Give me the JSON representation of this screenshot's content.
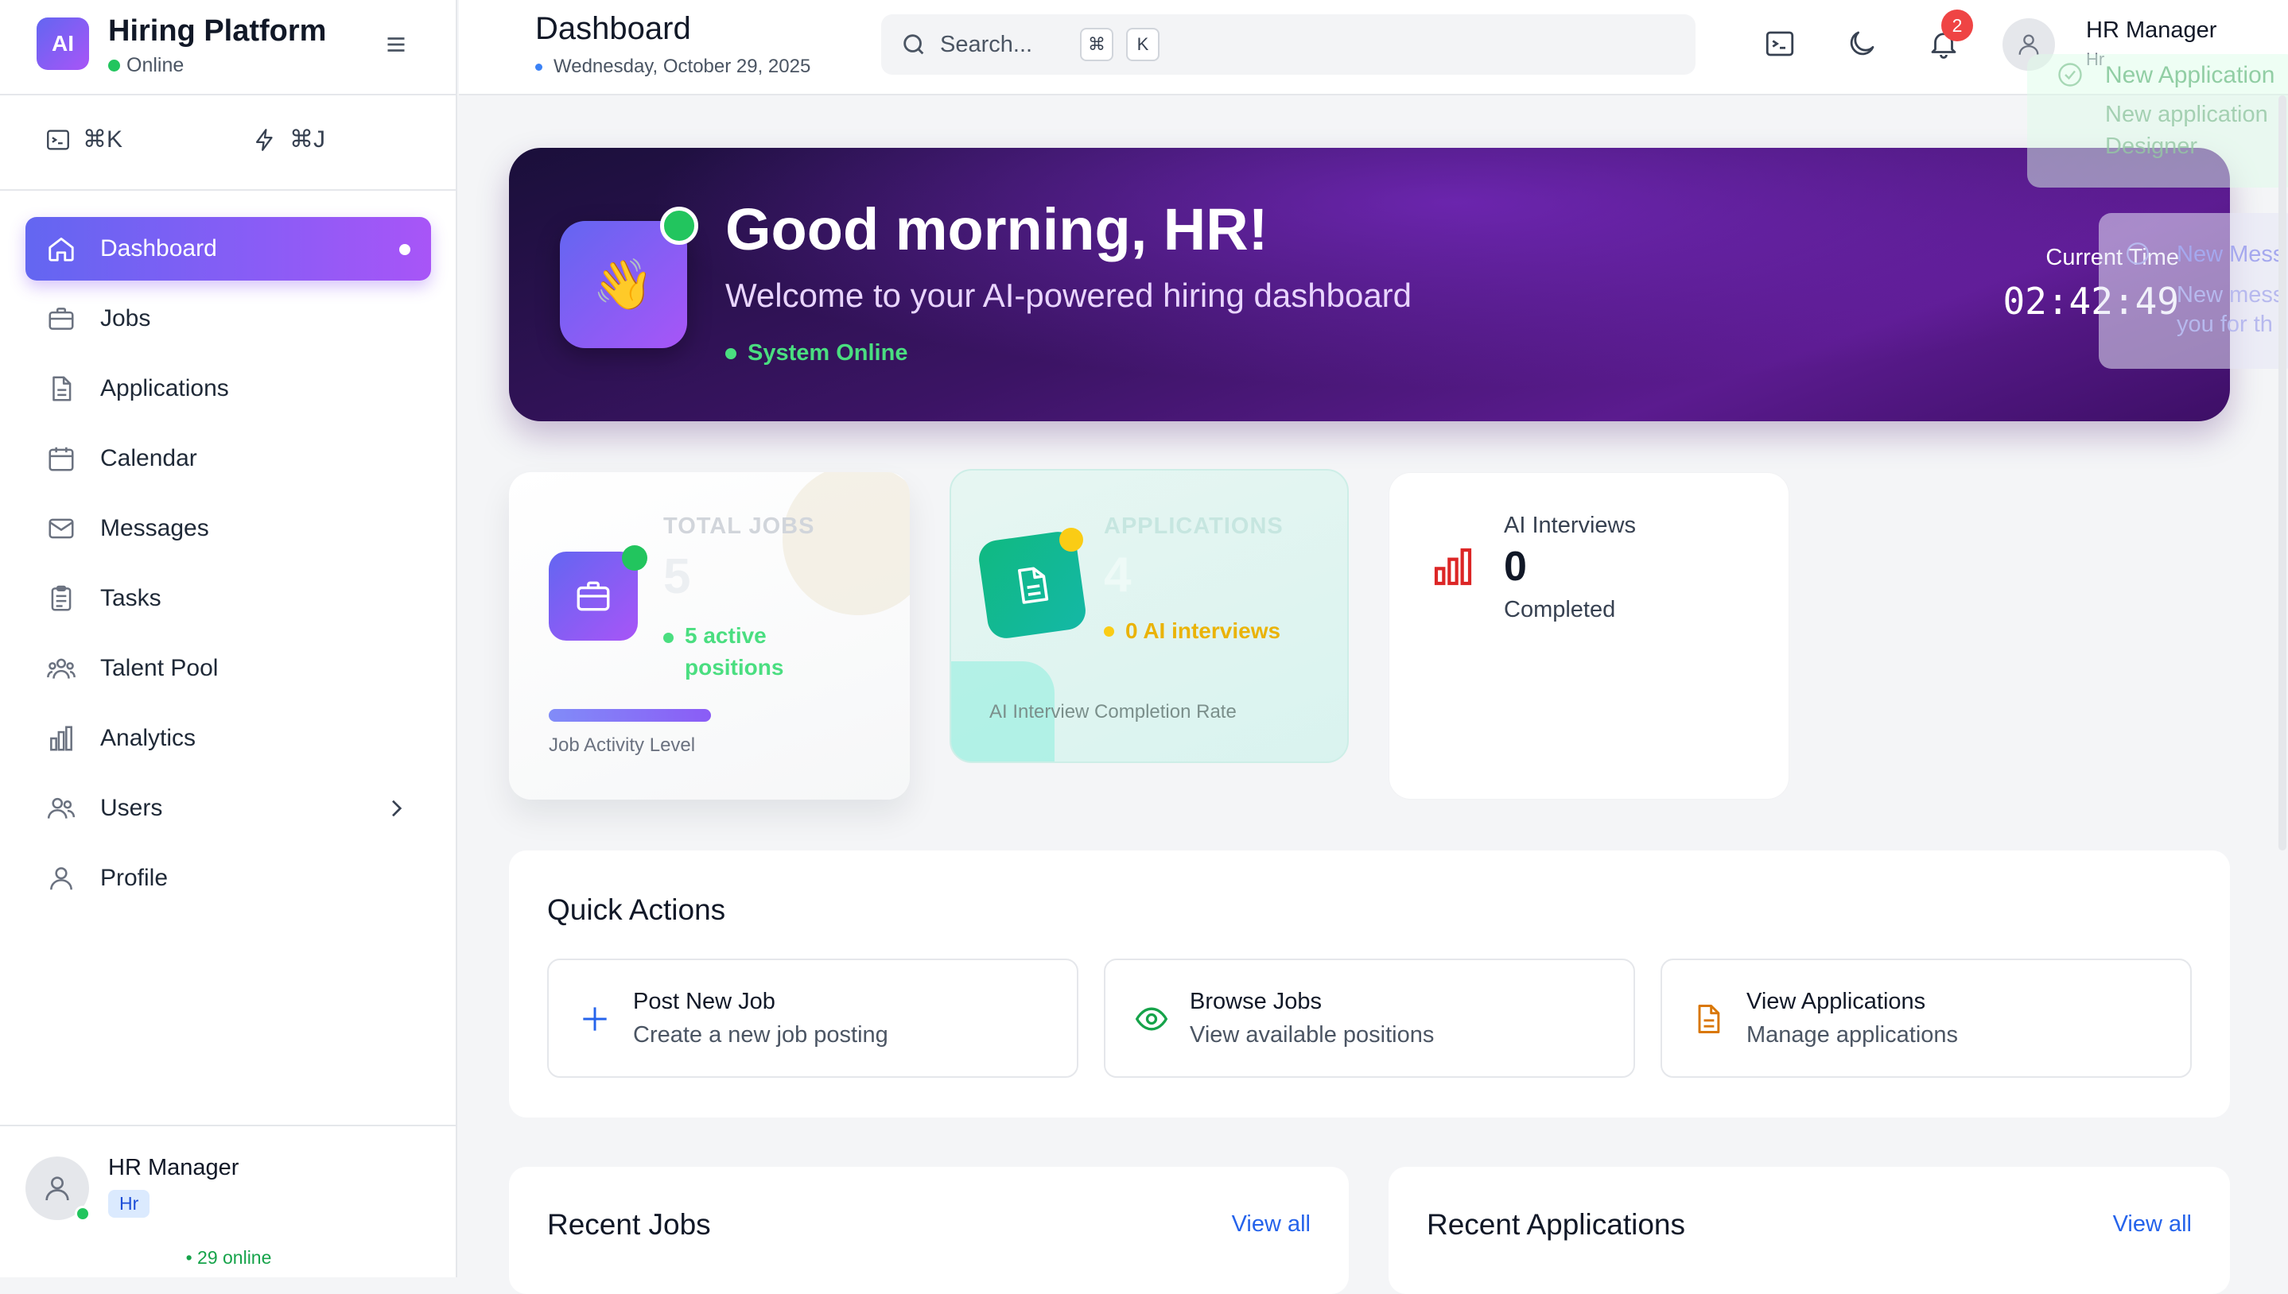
{
  "sidebar": {
    "logo_text": "AI",
    "app_title": "Hiring Platform",
    "status": "Online",
    "shortcuts": [
      {
        "icon": "terminal-icon",
        "label": "⌘K"
      },
      {
        "icon": "bolt-icon",
        "label": "⌘J"
      }
    ],
    "nav": [
      {
        "label": "Dashboard",
        "icon": "home-icon",
        "active": true
      },
      {
        "label": "Jobs",
        "icon": "briefcase-icon"
      },
      {
        "label": "Applications",
        "icon": "document-icon"
      },
      {
        "label": "Calendar",
        "icon": "calendar-icon"
      },
      {
        "label": "Messages",
        "icon": "mail-icon"
      },
      {
        "label": "Tasks",
        "icon": "clipboard-icon"
      },
      {
        "label": "Talent Pool",
        "icon": "group-icon"
      },
      {
        "label": "Analytics",
        "icon": "bar-chart-icon"
      },
      {
        "label": "Users",
        "icon": "users-icon",
        "has_submenu": true
      },
      {
        "label": "Profile",
        "icon": "user-icon"
      }
    ],
    "user": {
      "name": "HR Manager",
      "role": "Hr",
      "online_count": "• 29 online"
    }
  },
  "header": {
    "title": "Dashboard",
    "date": "Wednesday, October 29, 2025",
    "search": {
      "placeholder": "Search...",
      "kbd_1": "⌘",
      "kbd_2": "K"
    },
    "notifications_count": "2",
    "user_name": "HR Manager",
    "user_role": "Hr"
  },
  "hero": {
    "emoji": "👋",
    "greeting": "Good morning, HR!",
    "subtitle": "Welcome to your AI-powered hiring dashboard",
    "status": "System Online",
    "time_label": "Current Time",
    "time": "02:42:49"
  },
  "toasts": [
    {
      "title": "New Application",
      "line1": "New application",
      "line2": "Designer"
    },
    {
      "title": "New Mess",
      "line1": "New mess",
      "line2": "you for th"
    }
  ],
  "stats": {
    "jobs": {
      "label": "TOTAL JOBS",
      "value": "5",
      "active": "5 active positions",
      "sub": "Job Activity Level",
      "activity_level": 1.0
    },
    "applications": {
      "label": "APPLICATIONS",
      "value": "4",
      "ai": "0 AI interviews",
      "sub": "AI Interview Completion Rate"
    },
    "ai_interviews": {
      "label": "AI Interviews",
      "value": "0",
      "sub": "Completed"
    }
  },
  "quick_actions": {
    "title": "Quick Actions",
    "items": [
      {
        "title": "Post New Job",
        "sub": "Create a new job posting",
        "icon": "plus-icon",
        "color": "#2563eb"
      },
      {
        "title": "Browse Jobs",
        "sub": "View available positions",
        "icon": "eye-icon",
        "color": "#16a34a"
      },
      {
        "title": "View Applications",
        "sub": "Manage applications",
        "icon": "file-icon",
        "color": "#d97706"
      }
    ]
  },
  "recent": {
    "jobs": {
      "title": "Recent Jobs",
      "link": "View all"
    },
    "applications": {
      "title": "Recent Applications",
      "link": "View all"
    }
  },
  "colors": {
    "accent": "#7c3aed",
    "online": "#22c55e",
    "link": "#2563eb"
  }
}
